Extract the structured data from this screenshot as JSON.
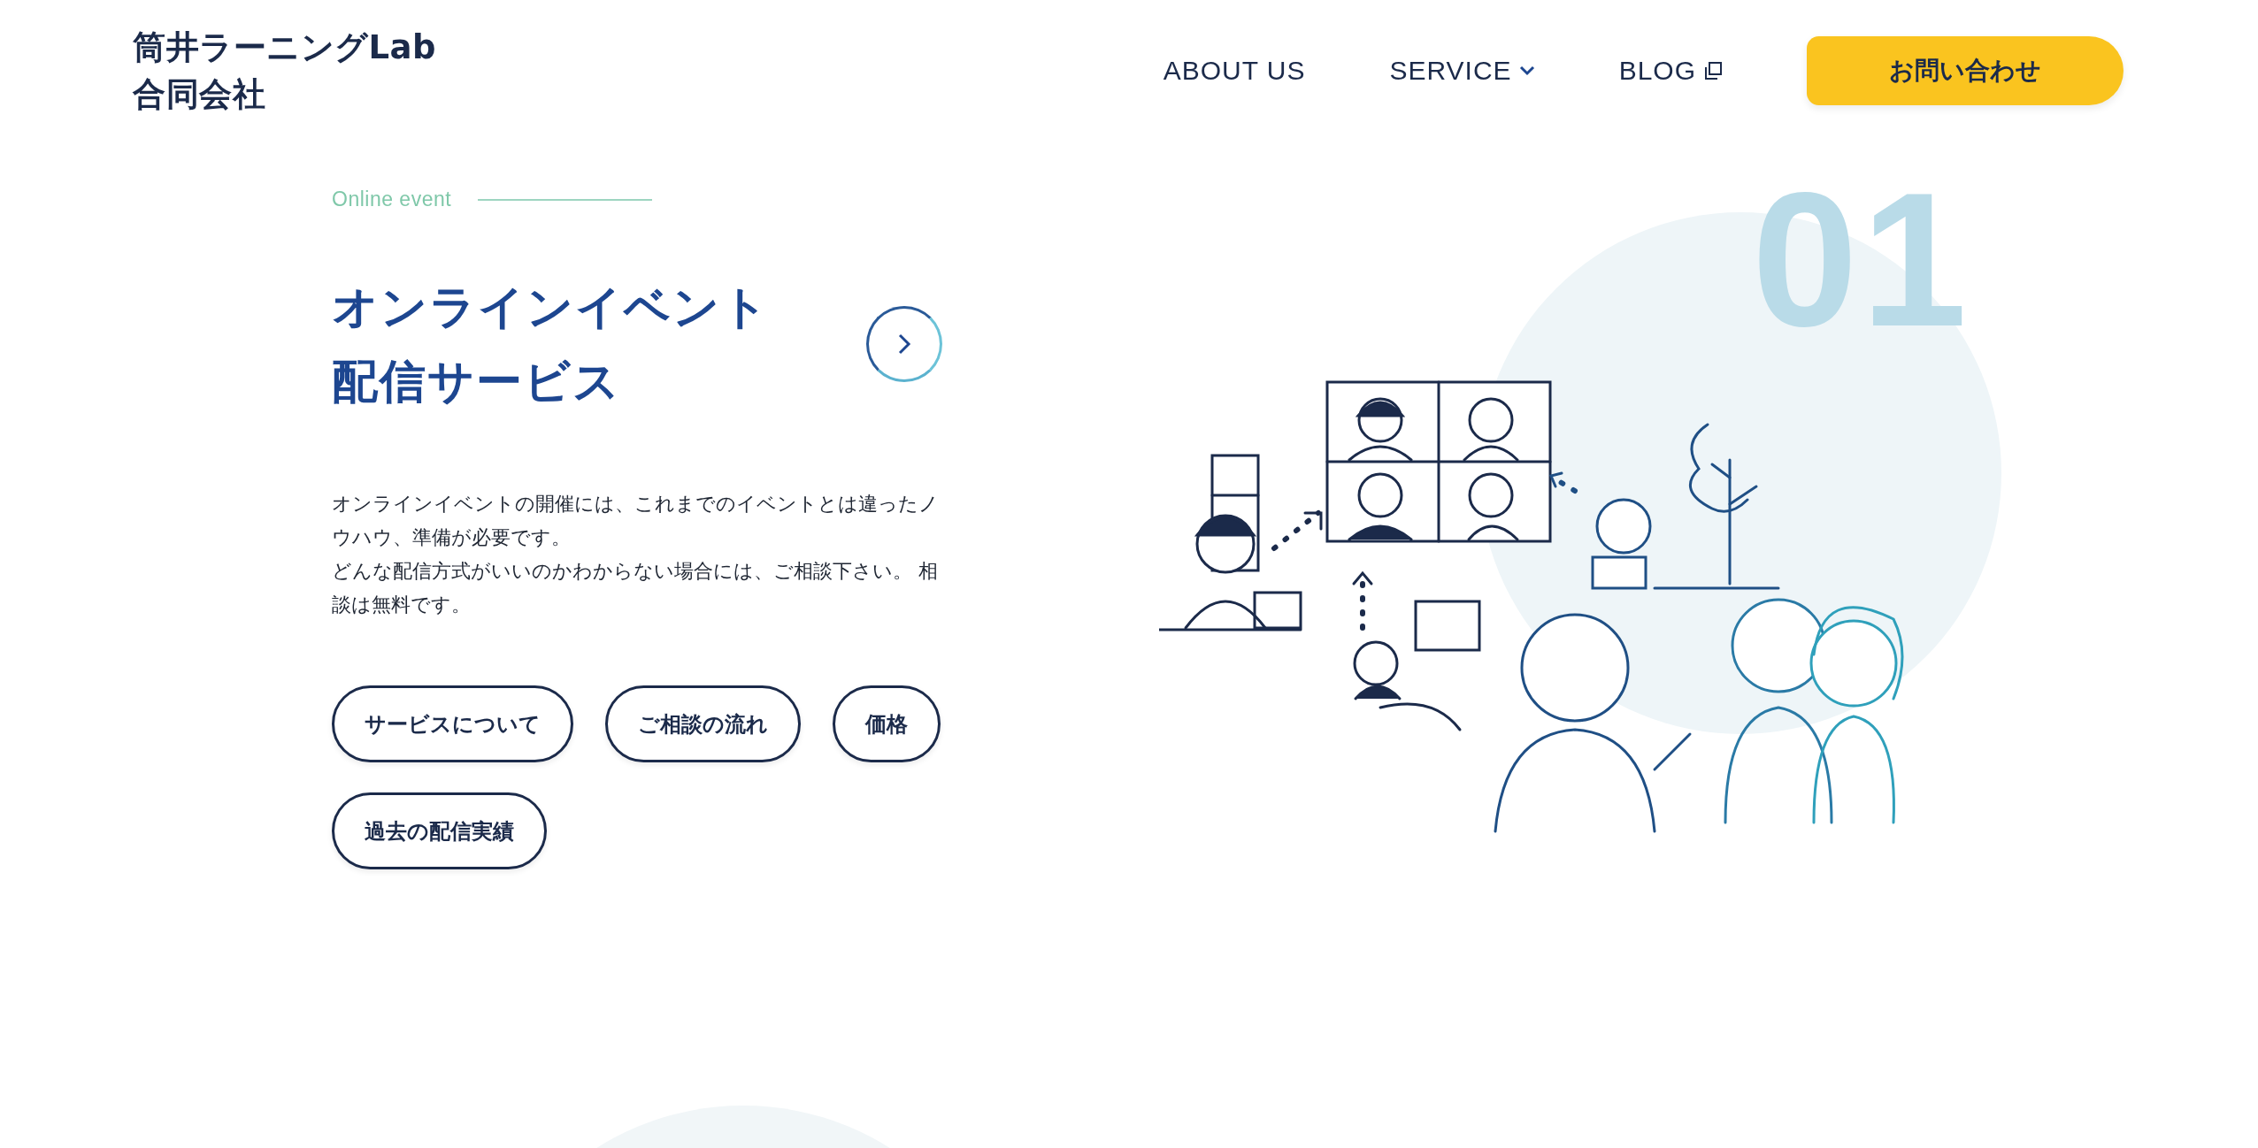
{
  "header": {
    "logo": [
      "筒井ラーニングLab",
      "合同会社"
    ],
    "nav": [
      {
        "label": "ABOUT US",
        "kind": "plain"
      },
      {
        "label": "SERVICE",
        "kind": "dropdown"
      },
      {
        "label": "BLOG",
        "kind": "external"
      }
    ],
    "contact_button": "お問い合わせ"
  },
  "service": {
    "eyebrow": "Online event",
    "number": "01",
    "title": [
      "オンラインイベント",
      "配信サービス"
    ],
    "description": [
      "オンラインイベントの開催には、これまでのイベントとは違ったノウハウ、準備が必要です。",
      "どんな配信方式がいいのかわからない場合には、ご相談下さい。 相談は無料です。"
    ],
    "links": [
      "サービスについて",
      "ご相談の流れ",
      "価格",
      "過去の配信実績"
    ]
  }
}
